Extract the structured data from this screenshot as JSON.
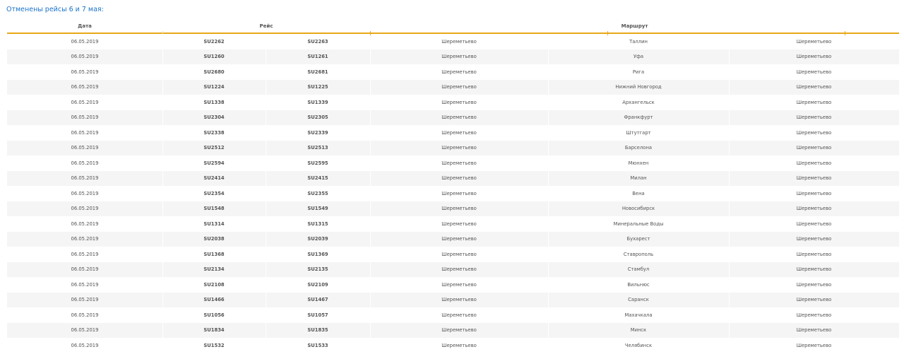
{
  "caption": "Отменены рейсы 6 и 7 мая:",
  "table": {
    "headers": {
      "date": "Дата",
      "flight": "Рейс",
      "route": "Маршрут"
    },
    "rows": [
      {
        "date": "06.05.2019",
        "flight_out": "SU2262",
        "flight_back": "SU2263",
        "from": "Шереметьево",
        "city": "Таллин",
        "to": "Шереметьево"
      },
      {
        "date": "06.05.2019",
        "flight_out": "SU1260",
        "flight_back": "SU1261",
        "from": "Шереметьево",
        "city": "Уфа",
        "to": "Шереметьево"
      },
      {
        "date": "06.05.2019",
        "flight_out": "SU2680",
        "flight_back": "SU2681",
        "from": "Шереметьево",
        "city": "Рига",
        "to": "Шереметьево"
      },
      {
        "date": "06.05.2019",
        "flight_out": "SU1224",
        "flight_back": "SU1225",
        "from": "Шереметьево",
        "city": "Нижний Новгород",
        "to": "Шереметьево"
      },
      {
        "date": "06.05.2019",
        "flight_out": "SU1338",
        "flight_back": "SU1339",
        "from": "Шереметьево",
        "city": "Архангельск",
        "to": "Шереметьево"
      },
      {
        "date": "06.05.2019",
        "flight_out": "SU2304",
        "flight_back": "SU2305",
        "from": "Шереметьево",
        "city": "Франкфурт",
        "to": "Шереметьево"
      },
      {
        "date": "06.05.2019",
        "flight_out": "SU2338",
        "flight_back": "SU2339",
        "from": "Шереметьево",
        "city": "Штутгарт",
        "to": "Шереметьево"
      },
      {
        "date": "06.05.2019",
        "flight_out": "SU2512",
        "flight_back": "SU2513",
        "from": "Шереметьево",
        "city": "Барселона",
        "to": "Шереметьево"
      },
      {
        "date": "06.05.2019",
        "flight_out": "SU2594",
        "flight_back": "SU2595",
        "from": "Шереметьево",
        "city": "Мюнхен",
        "to": "Шереметьево"
      },
      {
        "date": "06.05.2019",
        "flight_out": "SU2414",
        "flight_back": "SU2415",
        "from": "Шереметьево",
        "city": "Милан",
        "to": "Шереметьево"
      },
      {
        "date": "06.05.2019",
        "flight_out": "SU2354",
        "flight_back": "SU2355",
        "from": "Шереметьево",
        "city": "Вена",
        "to": "Шереметьево"
      },
      {
        "date": "06.05.2019",
        "flight_out": "SU1548",
        "flight_back": "SU1549",
        "from": "Шереметьево",
        "city": "Новосибирск",
        "to": "Шереметьево"
      },
      {
        "date": "06.05.2019",
        "flight_out": "SU1314",
        "flight_back": "SU1315",
        "from": "Шереметьево",
        "city": "Минеральные Воды",
        "to": "Шереметьево"
      },
      {
        "date": "06.05.2019",
        "flight_out": "SU2038",
        "flight_back": "SU2039",
        "from": "Шереметьево",
        "city": "Бухарест",
        "to": "Шереметьево"
      },
      {
        "date": "06.05.2019",
        "flight_out": "SU1368",
        "flight_back": "SU1369",
        "from": "Шереметьево",
        "city": "Ставрополь",
        "to": "Шереметьево"
      },
      {
        "date": "06.05.2019",
        "flight_out": "SU2134",
        "flight_back": "SU2135",
        "from": "Шереметьево",
        "city": "Стамбул",
        "to": "Шереметьево"
      },
      {
        "date": "06.05.2019",
        "flight_out": "SU2108",
        "flight_back": "SU2109",
        "from": "Шереметьево",
        "city": "Вильнюс",
        "to": "Шереметьево"
      },
      {
        "date": "06.05.2019",
        "flight_out": "SU1466",
        "flight_back": "SU1467",
        "from": "Шереметьево",
        "city": "Саранск",
        "to": "Шереметьево"
      },
      {
        "date": "06.05.2019",
        "flight_out": "SU1056",
        "flight_back": "SU1057",
        "from": "Шереметьево",
        "city": "Махачкала",
        "to": "Шереметьево"
      },
      {
        "date": "06.05.2019",
        "flight_out": "SU1834",
        "flight_back": "SU1835",
        "from": "Шереметьево",
        "city": "Минск",
        "to": "Шереметьево"
      },
      {
        "date": "06.05.2019",
        "flight_out": "SU1532",
        "flight_back": "SU1533",
        "from": "Шереметьево",
        "city": "Челябинск",
        "to": "Шереметьево"
      }
    ]
  }
}
